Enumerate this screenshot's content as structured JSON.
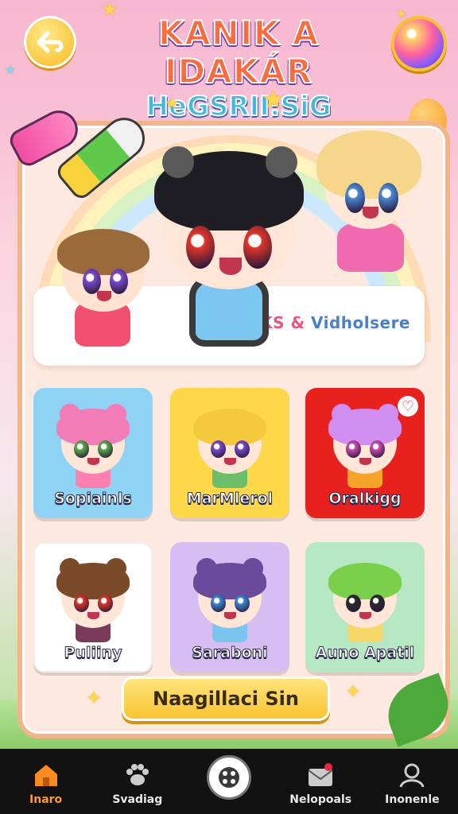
{
  "header": {
    "title_line1": "KANIK A IDAKÁR",
    "title_line2": "HeGSRII:SiG",
    "back_icon": "back-arrow-icon",
    "orb_icon": "magic-orb-icon"
  },
  "banner": {
    "text": "Vidholsere",
    "prefix": "KS &"
  },
  "characters": [
    {
      "label": "Sopiainls",
      "bg": "#8fd3f4",
      "hair": "#f27bb8",
      "eye": "#5ab04a",
      "outfit": "#ff7fb0",
      "ears": true
    },
    {
      "label": "MarMlerol",
      "bg": "#ffd84a",
      "hair": "#f5c93c",
      "eye": "#7a4ad0",
      "outfit": "#6cbf6a",
      "ears": false
    },
    {
      "label": "Oralkigg",
      "bg": "#e8201e",
      "hair": "#cf8ef0",
      "eye": "#d04ab0",
      "outfit": "#f5a42a",
      "ears": true,
      "favorite": true
    },
    {
      "label": "Puliiny",
      "bg": "#ffffff",
      "hair": "#7a4a2a",
      "eye": "#e0352a",
      "outfit": "#7a3a5a",
      "ears": true
    },
    {
      "label": "Saraboni",
      "bg": "#d6bdf2",
      "hair": "#6a4a9a",
      "eye": "#3a8ad8",
      "outfit": "#7ac4f0",
      "ears": true
    },
    {
      "label": "Auno Apatil",
      "bg": "#b6e8c4",
      "hair": "#7ad04a",
      "eye": "#2a2a2a",
      "outfit": "#f5d76a",
      "ears": false
    }
  ],
  "action_button": {
    "label": "Naagillaci Sin"
  },
  "nav": [
    {
      "label": "Inaro",
      "icon": "home-icon",
      "active": true
    },
    {
      "label": "Svadiag",
      "icon": "paw-icon",
      "active": false
    },
    {
      "label": "",
      "icon": "gamepad-icon",
      "active": false
    },
    {
      "label": "Nelopoals",
      "icon": "mail-icon",
      "active": false
    },
    {
      "label": "Inonenle",
      "icon": "profile-icon",
      "active": false
    }
  ]
}
